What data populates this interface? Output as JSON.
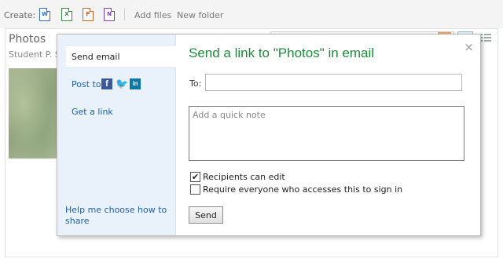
{
  "toolbar": {
    "create_label": "Create:",
    "icons": [
      {
        "name": "word-doc-icon",
        "glyph": "W"
      },
      {
        "name": "excel-doc-icon",
        "glyph": "X"
      },
      {
        "name": "powerpoint-doc-icon",
        "glyph": "P"
      },
      {
        "name": "onenote-doc-icon",
        "glyph": "N"
      }
    ],
    "add_files": "Add files",
    "new_folder": "New folder"
  },
  "page": {
    "title": "Photos",
    "owner": "Student P. Se"
  },
  "dialog": {
    "sidebar": {
      "send_email": "Send email",
      "post_to": "Post to",
      "social": {
        "facebook": "f",
        "twitter": "🐦",
        "linkedin": "in"
      },
      "get_link": "Get a link",
      "help": "Help me choose how to share"
    },
    "title": "Send a link to \"Photos\" in email",
    "close": "×",
    "to_label": "To:",
    "to_value": "",
    "note_placeholder": "Add a quick note",
    "options": [
      {
        "label": "Recipients can edit",
        "checked": true,
        "mark": "✔"
      },
      {
        "label": "Require everyone who accesses this to sign in",
        "checked": false,
        "mark": ""
      }
    ],
    "send_label": "Send"
  },
  "colors": {
    "title_green": "#1e8c3c",
    "link_blue": "#1f5fa8",
    "sidebar_bg": "#e9f1fb"
  }
}
